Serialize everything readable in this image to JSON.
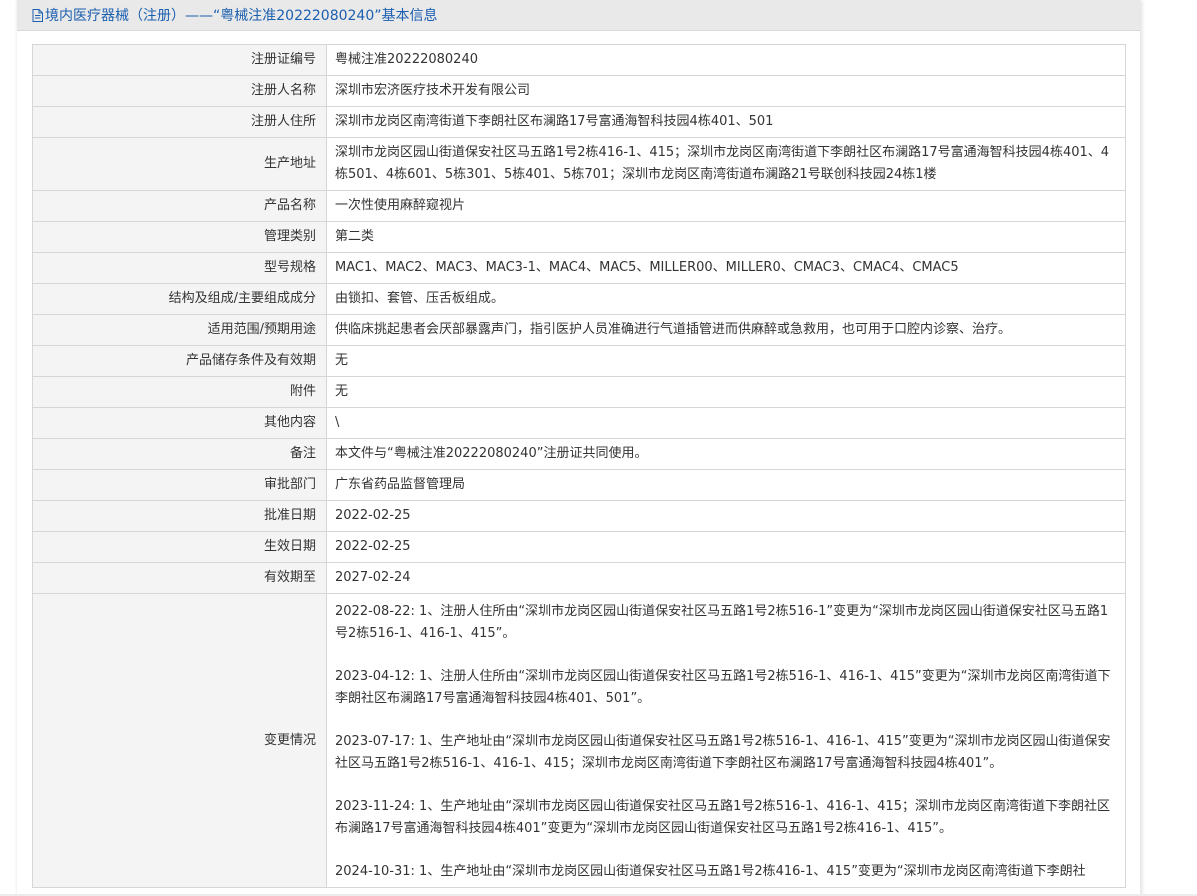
{
  "header": {
    "title": "境内医疗器械（注册）——“粤械注准20222080240”基本信息",
    "icon": "document-icon"
  },
  "fields": [
    {
      "label": "注册证编号",
      "value": "粤械注准20222080240"
    },
    {
      "label": "注册人名称",
      "value": "深圳市宏济医疗技术开发有限公司"
    },
    {
      "label": "注册人住所",
      "value": "深圳市龙岗区南湾街道下李朗社区布澜路17号富通海智科技园4栋401、501"
    },
    {
      "label": "生产地址",
      "value": "深圳市龙岗区园山街道保安社区马五路1号2栋416-1、415；深圳市龙岗区南湾街道下李朗社区布澜路17号富通海智科技园4栋401、4栋501、4栋601、5栋301、5栋401、5栋701；深圳市龙岗区南湾街道布澜路21号联创科技园24栋1楼"
    },
    {
      "label": "产品名称",
      "value": "一次性使用麻醉窥视片"
    },
    {
      "label": "管理类别",
      "value": "第二类"
    },
    {
      "label": "型号规格",
      "value": "MAC1、MAC2、MAC3、MAC3-1、MAC4、MAC5、MILLER00、MILLER0、CMAC3、CMAC4、CMAC5"
    },
    {
      "label": "结构及组成/主要组成成分",
      "value": "由锁扣、套管、压舌板组成。"
    },
    {
      "label": "适用范围/预期用途",
      "value": "供临床挑起患者会厌部暴露声门，指引医护人员准确进行气道插管进而供麻醉或急救用，也可用于口腔内诊察、治疗。"
    },
    {
      "label": "产品储存条件及有效期",
      "value": "无"
    },
    {
      "label": "附件",
      "value": "无"
    },
    {
      "label": "其他内容",
      "value": "\\"
    },
    {
      "label": "备注",
      "value": "本文件与“粤械注准20222080240”注册证共同使用。"
    },
    {
      "label": "审批部门",
      "value": "广东省药品监督管理局"
    },
    {
      "label": "批准日期",
      "value": "2022-02-25"
    },
    {
      "label": "生效日期",
      "value": "2022-02-25"
    },
    {
      "label": "有效期至",
      "value": "2027-02-24"
    }
  ],
  "changes": {
    "label": "变更情况",
    "entries": [
      "2022-08-22: 1、注册人住所由“深圳市龙岗区园山街道保安社区马五路1号2栋516-1”变更为“深圳市龙岗区园山街道保安社区马五路1号2栋516-1、416-1、415”。",
      "2023-04-12: 1、注册人住所由“深圳市龙岗区园山街道保安社区马五路1号2栋516-1、416-1、415”变更为“深圳市龙岗区南湾街道下李朗社区布澜路17号富通海智科技园4栋401、501”。",
      "2023-07-17: 1、生产地址由“深圳市龙岗区园山街道保安社区马五路1号2栋516-1、416-1、415”变更为“深圳市龙岗区园山街道保安社区马五路1号2栋516-1、416-1、415；深圳市龙岗区南湾街道下李朗社区布澜路17号富通海智科技园4栋401”。",
      "2023-11-24: 1、生产地址由“深圳市龙岗区园山街道保安社区马五路1号2栋516-1、416-1、415；深圳市龙岗区南湾街道下李朗社区布澜路17号富通海智科技园4栋401”变更为“深圳市龙岗区园山街道保安社区马五路1号2栋416-1、415”。",
      "2024-10-31: 1、生产地址由“深圳市龙岗区园山街道保安社区马五路1号2栋416-1、415”变更为“深圳市龙岗区南湾街道下李朗社"
    ]
  },
  "colors": {
    "title": "#1b5fb0",
    "header_bg": "#e9e9e9",
    "label_bg": "#f4f4f4",
    "border": "#d6d6d6"
  }
}
